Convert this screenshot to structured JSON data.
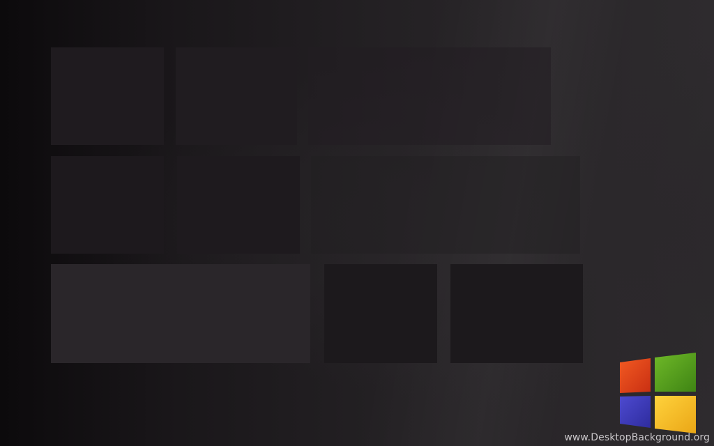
{
  "wallpaper": {
    "watermark_text": "www.DesktopBackground.org"
  },
  "logo": {
    "icon": "windows-logo-icon",
    "colors": {
      "red": "#e8431c",
      "green": "#58a11c",
      "blue": "#3d3bbd",
      "yellow": "#f7c12a"
    }
  },
  "colors": {
    "background_dark": "#0c0a0c",
    "background_light": "#2e2b2e",
    "tile": "#1f1b1f"
  }
}
